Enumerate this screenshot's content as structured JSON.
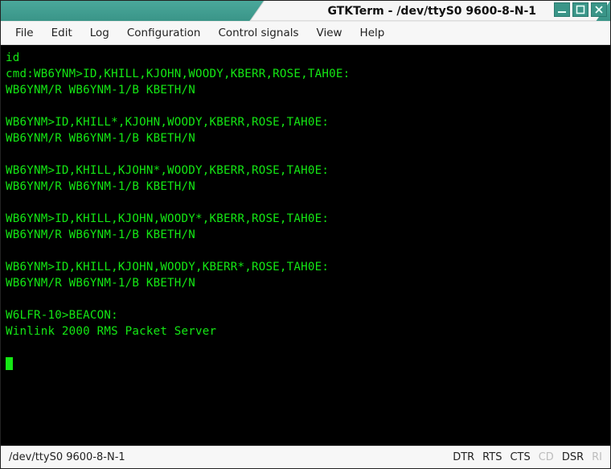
{
  "window": {
    "title": "GTKTerm - /dev/ttyS0 9600-8-N-1"
  },
  "menubar": {
    "items": [
      "File",
      "Edit",
      "Log",
      "Configuration",
      "Control signals",
      "View",
      "Help"
    ]
  },
  "terminal": {
    "lines": [
      "id",
      "cmd:WB6YNM>ID,KHILL,KJOHN,WOODY,KBERR,ROSE,TAH0E:",
      "WB6YNM/R WB6YNM-1/B KBETH/N",
      "",
      "WB6YNM>ID,KHILL*,KJOHN,WOODY,KBERR,ROSE,TAH0E:",
      "WB6YNM/R WB6YNM-1/B KBETH/N",
      "",
      "WB6YNM>ID,KHILL,KJOHN*,WOODY,KBERR,ROSE,TAH0E:",
      "WB6YNM/R WB6YNM-1/B KBETH/N",
      "",
      "WB6YNM>ID,KHILL,KJOHN,WOODY*,KBERR,ROSE,TAH0E:",
      "WB6YNM/R WB6YNM-1/B KBETH/N",
      "",
      "WB6YNM>ID,KHILL,KJOHN,WOODY,KBERR*,ROSE,TAH0E:",
      "WB6YNM/R WB6YNM-1/B KBETH/N",
      "",
      "W6LFR-10>BEACON:",
      "Winlink 2000 RMS Packet Server",
      ""
    ]
  },
  "statusbar": {
    "left": "/dev/ttyS0  9600-8-N-1",
    "signals": [
      {
        "name": "DTR",
        "active": true
      },
      {
        "name": "RTS",
        "active": true
      },
      {
        "name": "CTS",
        "active": true
      },
      {
        "name": "CD",
        "active": false
      },
      {
        "name": "DSR",
        "active": true
      },
      {
        "name": "RI",
        "active": false
      }
    ]
  }
}
